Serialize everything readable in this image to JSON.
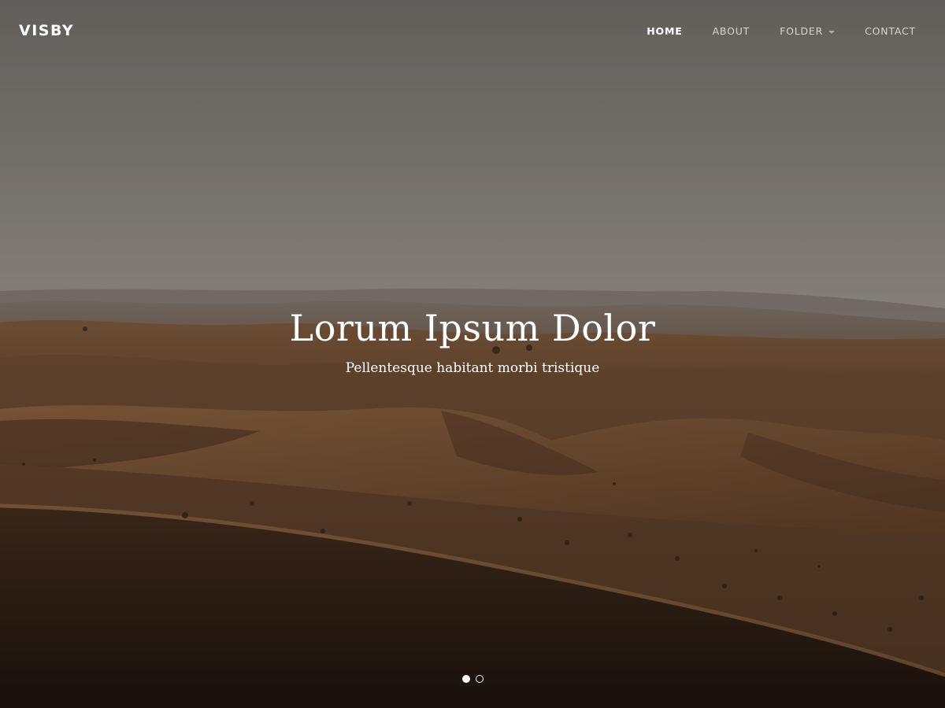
{
  "site": {
    "logo": "VISBY"
  },
  "nav": {
    "items": [
      {
        "label": "HOME",
        "active": true
      },
      {
        "label": "ABOUT",
        "active": false
      },
      {
        "label": "FOLDER",
        "active": false,
        "has_dropdown": true
      },
      {
        "label": "CONTACT",
        "active": false
      }
    ]
  },
  "hero": {
    "title": "Lorum Ipsum Dolor",
    "subtitle": "Pellentesque habitant morbi tristique",
    "background": "desert-dunes-photo"
  },
  "slider": {
    "slide_count": 2,
    "active_index": 0
  },
  "colors": {
    "sky": "#7d7873",
    "sand": "#6a4a30",
    "text": "#ffffff"
  }
}
